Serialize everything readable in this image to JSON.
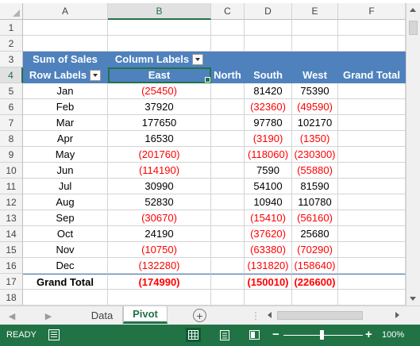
{
  "grid": {
    "columns": [
      "A",
      "B",
      "C",
      "D",
      "E",
      "F"
    ],
    "rows": [
      "1",
      "2",
      "3",
      "4",
      "5",
      "6",
      "7",
      "8",
      "9",
      "10",
      "11",
      "12",
      "13",
      "14",
      "15",
      "16",
      "17",
      "18"
    ],
    "selected_column": "B",
    "selected_row": "4"
  },
  "pivot": {
    "sum_label": "Sum of Sales",
    "column_labels": "Column Labels",
    "row_labels": "Row Labels",
    "headers": [
      "East",
      "North",
      "South",
      "West",
      "Grand Total"
    ],
    "rows": [
      {
        "label": "Jan",
        "east": "(25450)",
        "north": "",
        "south": "81420",
        "west": "75390",
        "total": ""
      },
      {
        "label": "Feb",
        "east": "37920",
        "north": "",
        "south": "(32360)",
        "west": "(49590)",
        "total": ""
      },
      {
        "label": "Mar",
        "east": "177650",
        "north": "",
        "south": "97780",
        "west": "102170",
        "total": ""
      },
      {
        "label": "Apr",
        "east": "16530",
        "north": "",
        "south": "(3190)",
        "west": "(1350)",
        "total": ""
      },
      {
        "label": "May",
        "east": "(201760)",
        "north": "",
        "south": "(118060)",
        "west": "(230300)",
        "total": ""
      },
      {
        "label": "Jun",
        "east": "(114190)",
        "north": "",
        "south": "7590",
        "west": "(55880)",
        "total": ""
      },
      {
        "label": "Jul",
        "east": "30990",
        "north": "",
        "south": "54100",
        "west": "81590",
        "total": ""
      },
      {
        "label": "Aug",
        "east": "52830",
        "north": "",
        "south": "10940",
        "west": "110780",
        "total": ""
      },
      {
        "label": "Sep",
        "east": "(30670)",
        "north": "",
        "south": "(15410)",
        "west": "(56160)",
        "total": ""
      },
      {
        "label": "Oct",
        "east": "24190",
        "north": "",
        "south": "(37620)",
        "west": "25680",
        "total": ""
      },
      {
        "label": "Nov",
        "east": "(10750)",
        "north": "",
        "south": "(63380)",
        "west": "(70290)",
        "total": ""
      },
      {
        "label": "Dec",
        "east": "(132280)",
        "north": "",
        "south": "(131820)",
        "west": "(158640)",
        "total": ""
      }
    ],
    "grand_total": {
      "label": "Grand Total",
      "east": "(174990)",
      "north": "",
      "south": "(150010)",
      "west": "(226600)",
      "total": ""
    }
  },
  "tabs": {
    "items": [
      "Data",
      "Pivot"
    ],
    "active": "Pivot"
  },
  "status": {
    "ready": "READY",
    "zoom": "100%",
    "zoom_minus": "−",
    "zoom_plus": "+"
  },
  "colors": {
    "header_fill": "#4f81bd",
    "negative": "#ff0000",
    "excel_green": "#217346"
  }
}
